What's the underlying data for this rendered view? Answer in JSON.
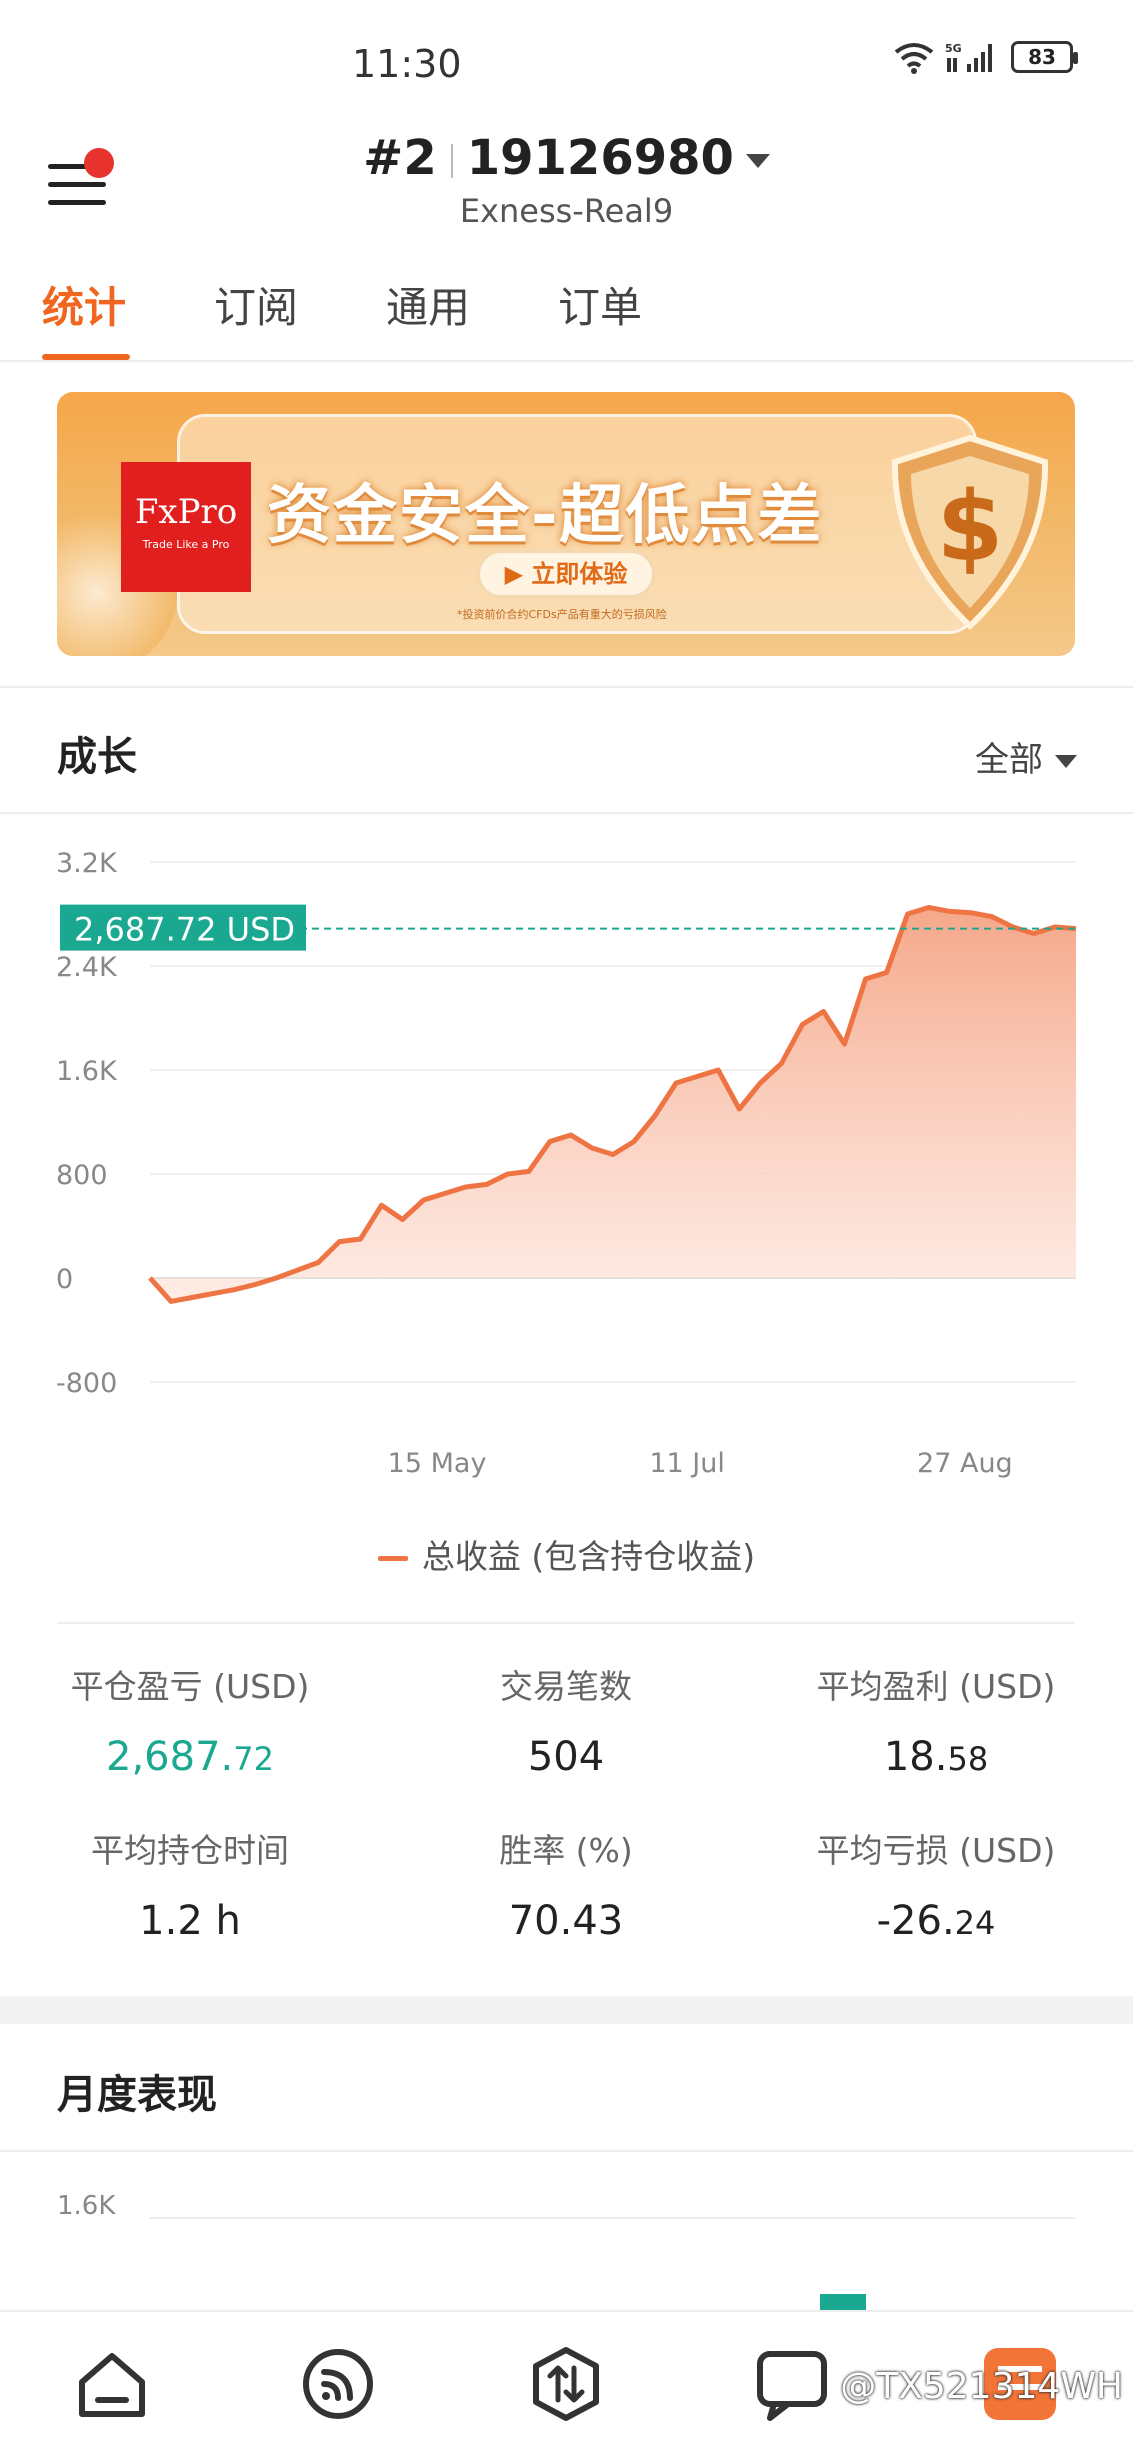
{
  "status_bar": {
    "time": "11:30",
    "battery": "83"
  },
  "header": {
    "account_number": "#2",
    "account_id": "19126980",
    "server": "Exness-Real9"
  },
  "tabs": [
    {
      "label": "统计",
      "active": true
    },
    {
      "label": "订阅",
      "active": false
    },
    {
      "label": "通用",
      "active": false
    },
    {
      "label": "订单",
      "active": false
    }
  ],
  "banner": {
    "brand": "FxPro",
    "brand_tagline": "Trade Like a Pro",
    "headline": "资金安全-超低点差",
    "cta": "立即体验",
    "note": "*投资前价合约CFDs产品有重大的亏损风险"
  },
  "growth": {
    "title": "成长",
    "filter": "全部",
    "current_value_label": "2,687.72 USD",
    "legend": "总收益 (包含持仓收益)"
  },
  "chart_data": {
    "type": "area",
    "y_ticks": [
      "3.2K",
      "2.4K",
      "1.6K",
      "800",
      "0",
      "-800"
    ],
    "ylim": [
      -800,
      3200
    ],
    "x_ticks": [
      "15 May",
      "11 Jul",
      "27 Aug"
    ],
    "series": [
      {
        "name": "总收益 (包含持仓收益)",
        "color": "#ef7443",
        "values": [
          0,
          -180,
          -150,
          -120,
          -90,
          -50,
          0,
          60,
          120,
          280,
          300,
          560,
          450,
          600,
          650,
          700,
          720,
          800,
          820,
          1050,
          1100,
          1000,
          950,
          1050,
          1250,
          1500,
          1550,
          1600,
          1300,
          1500,
          1650,
          1950,
          2050,
          1800,
          2300,
          2350,
          2800,
          2850,
          2820,
          2810,
          2780,
          2700,
          2650,
          2700,
          2687.72
        ]
      }
    ],
    "current_value": 2687.72
  },
  "stats": [
    {
      "label": "平仓盈亏 (USD)",
      "value_main": "2,687.",
      "value_small": "72",
      "highlight": true
    },
    {
      "label": "交易笔数",
      "value_main": "504",
      "value_small": "",
      "highlight": false
    },
    {
      "label": "平均盈利 (USD)",
      "value_main": "18.",
      "value_small": "58",
      "highlight": false
    },
    {
      "label": "平均持仓时间",
      "value_main": "1.2 h",
      "value_small": "",
      "highlight": false
    },
    {
      "label": "胜率 (%)",
      "value_main": "70.43",
      "value_small": "",
      "highlight": false
    },
    {
      "label": "平均亏损 (USD)",
      "value_main": "-26.",
      "value_small": "24",
      "highlight": false
    }
  ],
  "monthly": {
    "title": "月度表现",
    "y_tick": "1.6K"
  },
  "bottom_nav": {
    "items": [
      "home-icon",
      "feed-icon",
      "trade-icon",
      "chat-icon",
      "profile-icon"
    ],
    "watermark": "@TX521314WH"
  }
}
